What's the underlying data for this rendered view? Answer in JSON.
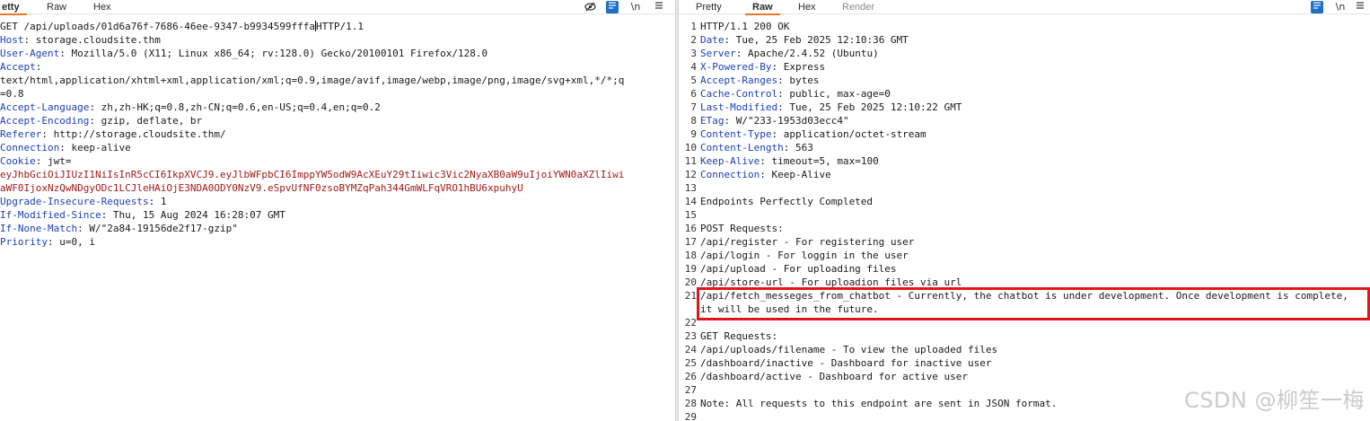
{
  "request": {
    "tabs": [
      "etty",
      "Raw",
      "Hex"
    ],
    "icons": [
      "eye-slash-icon",
      "wrap-lines-icon",
      "newline-icon",
      "menu-icon"
    ],
    "newline_label": "\\n",
    "lines": [
      {
        "type": "plain",
        "text": "GET /api/uploads/01d6a76f-7686-46ee-9347-b9934599fffa"
      },
      {
        "type": "header",
        "name": "Host",
        "value": "storage.cloudsite.thm"
      },
      {
        "type": "header",
        "name": "User-Agent",
        "value": "Mozilla/5.0 (X11; Linux x86_64; rv:128.0) Gecko/20100101 Firefox/128.0"
      },
      {
        "type": "header",
        "name": "Accept",
        "value": ""
      },
      {
        "type": "plain",
        "text": "text/html,application/xhtml+xml,application/xml;q=0.9,image/avif,image/webp,image/png,image/svg+xml,*/*;q"
      },
      {
        "type": "plain",
        "text": "=0.8"
      },
      {
        "type": "header",
        "name": "Accept-Language",
        "value": "zh,zh-HK;q=0.8,zh-CN;q=0.6,en-US;q=0.4,en;q=0.2"
      },
      {
        "type": "header",
        "name": "Accept-Encoding",
        "value": "gzip, deflate, br"
      },
      {
        "type": "header",
        "name": "Referer",
        "value": "http://storage.cloudsite.thm/"
      },
      {
        "type": "header",
        "name": "Connection",
        "value": "keep-alive"
      },
      {
        "type": "header",
        "name": "Cookie",
        "value": "jwt="
      },
      {
        "type": "cookie",
        "text": "eyJhbGciOiJIUzI1NiIsInR5cCI6IkpXVCJ9.eyJlbWFpbCI6ImppYW5odW9AcXEuY29tIiwic3Vic2NyaXB0aW9uIjoiYWN0aXZlIiwi"
      },
      {
        "type": "cookie",
        "text": "aWF0IjoxNzQwNDgyODc1LCJleHAiOjE3NDA0ODY0NzV9.eSpvUfNF0zsoBYMZqPah344GmWLFqVRO1hBU6xpuhyU"
      },
      {
        "type": "header",
        "name": "Upgrade-Insecure-Requests",
        "value": "1"
      },
      {
        "type": "header",
        "name": "If-Modified-Since",
        "value": "Thu, 15 Aug 2024 16:28:07 GMT"
      },
      {
        "type": "header",
        "name": "If-None-Match",
        "value": "W/\"2a84-19156de2f17-gzip\""
      },
      {
        "type": "header",
        "name": "Priority",
        "value": "u=0, i"
      }
    ],
    "first_line_tail": "HTTP/1.1"
  },
  "response": {
    "tabs": [
      "Pretty",
      "Raw",
      "Hex",
      "Render"
    ],
    "icons": [
      "wrap-lines-icon",
      "newline-icon",
      "menu-icon"
    ],
    "newline_label": "\\n",
    "lines": [
      {
        "n": "1",
        "type": "plain",
        "text": "HTTP/1.1 200 OK"
      },
      {
        "n": "2",
        "type": "header",
        "name": "Date",
        "value": "Tue, 25 Feb 2025 12:10:36 GMT"
      },
      {
        "n": "3",
        "type": "header",
        "name": "Server",
        "value": "Apache/2.4.52 (Ubuntu)"
      },
      {
        "n": "4",
        "type": "header",
        "name": "X-Powered-By",
        "value": "Express"
      },
      {
        "n": "5",
        "type": "header",
        "name": "Accept-Ranges",
        "value": "bytes"
      },
      {
        "n": "6",
        "type": "header",
        "name": "Cache-Control",
        "value": "public, max-age=0"
      },
      {
        "n": "7",
        "type": "header",
        "name": "Last-Modified",
        "value": "Tue, 25 Feb 2025 12:10:22 GMT"
      },
      {
        "n": "8",
        "type": "header",
        "name": "ETag",
        "value": "W/\"233-1953d03ecc4\""
      },
      {
        "n": "9",
        "type": "header",
        "name": "Content-Type",
        "value": "application/octet-stream"
      },
      {
        "n": "10",
        "type": "header",
        "name": "Content-Length",
        "value": "563"
      },
      {
        "n": "11",
        "type": "header",
        "name": "Keep-Alive",
        "value": "timeout=5, max=100"
      },
      {
        "n": "12",
        "type": "header",
        "name": "Connection",
        "value": "Keep-Alive"
      },
      {
        "n": "13",
        "type": "plain",
        "text": ""
      },
      {
        "n": "14",
        "type": "plain",
        "text": "Endpoints Perfectly Completed"
      },
      {
        "n": "15",
        "type": "plain",
        "text": ""
      },
      {
        "n": "16",
        "type": "plain",
        "text": "POST Requests:"
      },
      {
        "n": "17",
        "type": "plain",
        "text": "/api/register - For registering user"
      },
      {
        "n": "18",
        "type": "plain",
        "text": "/api/login - For loggin in the user"
      },
      {
        "n": "19",
        "type": "plain",
        "text": "/api/upload - For uploading files"
      },
      {
        "n": "20",
        "type": "plain",
        "text": "/api/store-url - For uploadion files via url"
      },
      {
        "n": "21",
        "type": "wrap",
        "text": "/api/fetch_messeges_from_chatbot - Currently, the chatbot is under development. Once development is complete, it will be used in the future."
      },
      {
        "n": "22",
        "type": "plain",
        "text": ""
      },
      {
        "n": "23",
        "type": "plain",
        "text": "GET Requests:"
      },
      {
        "n": "24",
        "type": "plain",
        "text": "/api/uploads/filename - To view the uploaded files"
      },
      {
        "n": "25",
        "type": "plain",
        "text": "/dashboard/inactive - Dashboard for inactive user"
      },
      {
        "n": "26",
        "type": "plain",
        "text": "/dashboard/active - Dashboard for active user"
      },
      {
        "n": "27",
        "type": "plain",
        "text": ""
      },
      {
        "n": "28",
        "type": "plain",
        "text": "Note: All requests to this endpoint are sent in JSON format."
      },
      {
        "n": "29",
        "type": "plain",
        "text": ""
      }
    ]
  },
  "watermark": "CSDN @柳笙一梅",
  "colors": {
    "header_name": "#1b3fb8",
    "cookie": "#a11a1a",
    "highlight": "#e0161b",
    "active_tab": "#e8792b"
  }
}
